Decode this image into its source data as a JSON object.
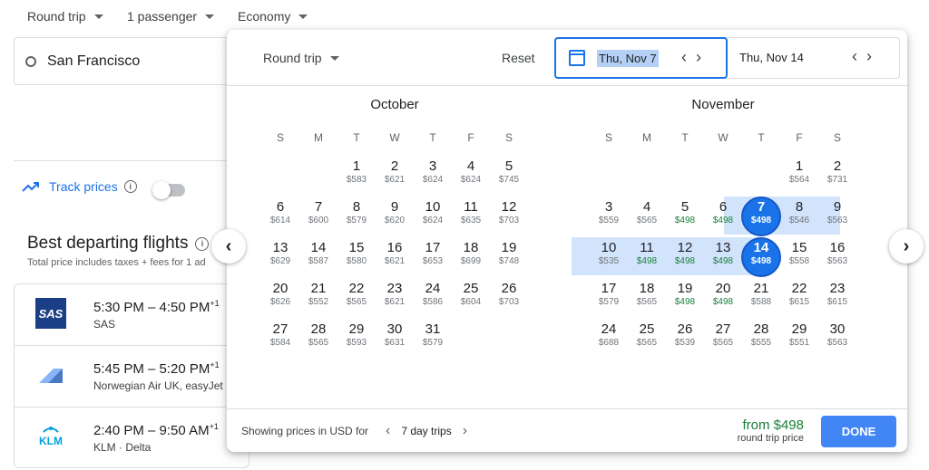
{
  "topbar": {
    "trip_type": "Round trip",
    "passengers": "1 passenger",
    "cabin": "Economy"
  },
  "search": {
    "origin": "San Francisco"
  },
  "track": {
    "label": "Track prices",
    "enabled": false
  },
  "best": {
    "title": "Best departing flights",
    "subtitle": "Total price includes taxes + fees for 1 ad"
  },
  "flights": [
    {
      "times": "5:30 PM – 4:50 PM",
      "plus": "+1",
      "airline": "SAS",
      "logo": "SAS"
    },
    {
      "times": "5:45 PM – 5:20 PM",
      "plus": "+1",
      "airline": "Norwegian Air UK, easyJet",
      "logo": "norwegian-logo"
    },
    {
      "times": "2:40 PM – 9:50 AM",
      "plus": "+1",
      "airline": "KLM · Delta",
      "logo": "KLM"
    }
  ],
  "popup": {
    "trip_type": "Round trip",
    "reset": "Reset",
    "departure": "Thu, Nov 7",
    "return": "Thu, Nov 14",
    "showing": "Showing prices in USD for",
    "trip_length": "7 day trips",
    "from_price": "from $498",
    "from_caption": "round trip price",
    "done": "DONE"
  },
  "weekdays": [
    "S",
    "M",
    "T",
    "W",
    "T",
    "F",
    "S"
  ],
  "months": [
    {
      "name": "October",
      "first_weekday": 2,
      "days": [
        {
          "d": "1",
          "p": "$583"
        },
        {
          "d": "2",
          "p": "$621"
        },
        {
          "d": "3",
          "p": "$624"
        },
        {
          "d": "4",
          "p": "$624"
        },
        {
          "d": "5",
          "p": "$745"
        },
        {
          "d": "6",
          "p": "$614"
        },
        {
          "d": "7",
          "p": "$600"
        },
        {
          "d": "8",
          "p": "$579"
        },
        {
          "d": "9",
          "p": "$620"
        },
        {
          "d": "10",
          "p": "$624"
        },
        {
          "d": "11",
          "p": "$635"
        },
        {
          "d": "12",
          "p": "$703"
        },
        {
          "d": "13",
          "p": "$629"
        },
        {
          "d": "14",
          "p": "$587"
        },
        {
          "d": "15",
          "p": "$580"
        },
        {
          "d": "16",
          "p": "$621"
        },
        {
          "d": "17",
          "p": "$653"
        },
        {
          "d": "18",
          "p": "$699"
        },
        {
          "d": "19",
          "p": "$748"
        },
        {
          "d": "20",
          "p": "$626"
        },
        {
          "d": "21",
          "p": "$552"
        },
        {
          "d": "22",
          "p": "$565"
        },
        {
          "d": "23",
          "p": "$621"
        },
        {
          "d": "24",
          "p": "$586"
        },
        {
          "d": "25",
          "p": "$604"
        },
        {
          "d": "26",
          "p": "$703"
        },
        {
          "d": "27",
          "p": "$584"
        },
        {
          "d": "28",
          "p": "$565"
        },
        {
          "d": "29",
          "p": "$593"
        },
        {
          "d": "30",
          "p": "$631"
        },
        {
          "d": "31",
          "p": "$579"
        }
      ]
    },
    {
      "name": "November",
      "first_weekday": 5,
      "days": [
        {
          "d": "1",
          "p": "$564"
        },
        {
          "d": "2",
          "p": "$731"
        },
        {
          "d": "3",
          "p": "$559"
        },
        {
          "d": "4",
          "p": "$565"
        },
        {
          "d": "5",
          "p": "$498",
          "low": true
        },
        {
          "d": "6",
          "p": "$498",
          "low": true
        },
        {
          "d": "7",
          "p": "$498",
          "low": true,
          "selected": true,
          "range": true
        },
        {
          "d": "8",
          "p": "$546",
          "range": true
        },
        {
          "d": "9",
          "p": "$563",
          "range": true
        },
        {
          "d": "10",
          "p": "$535",
          "range": true
        },
        {
          "d": "11",
          "p": "$498",
          "low": true,
          "range": true
        },
        {
          "d": "12",
          "p": "$498",
          "low": true,
          "range": true
        },
        {
          "d": "13",
          "p": "$498",
          "low": true,
          "range": true
        },
        {
          "d": "14",
          "p": "$498",
          "low": true,
          "selected": true,
          "range": true
        },
        {
          "d": "15",
          "p": "$558"
        },
        {
          "d": "16",
          "p": "$563"
        },
        {
          "d": "17",
          "p": "$579"
        },
        {
          "d": "18",
          "p": "$565"
        },
        {
          "d": "19",
          "p": "$498",
          "low": true
        },
        {
          "d": "20",
          "p": "$498",
          "low": true
        },
        {
          "d": "21",
          "p": "$588"
        },
        {
          "d": "22",
          "p": "$615"
        },
        {
          "d": "23",
          "p": "$615"
        },
        {
          "d": "24",
          "p": "$688"
        },
        {
          "d": "25",
          "p": "$565"
        },
        {
          "d": "26",
          "p": "$539"
        },
        {
          "d": "27",
          "p": "$565"
        },
        {
          "d": "28",
          "p": "$555"
        },
        {
          "d": "29",
          "p": "$551"
        },
        {
          "d": "30",
          "p": "$563"
        }
      ]
    }
  ]
}
